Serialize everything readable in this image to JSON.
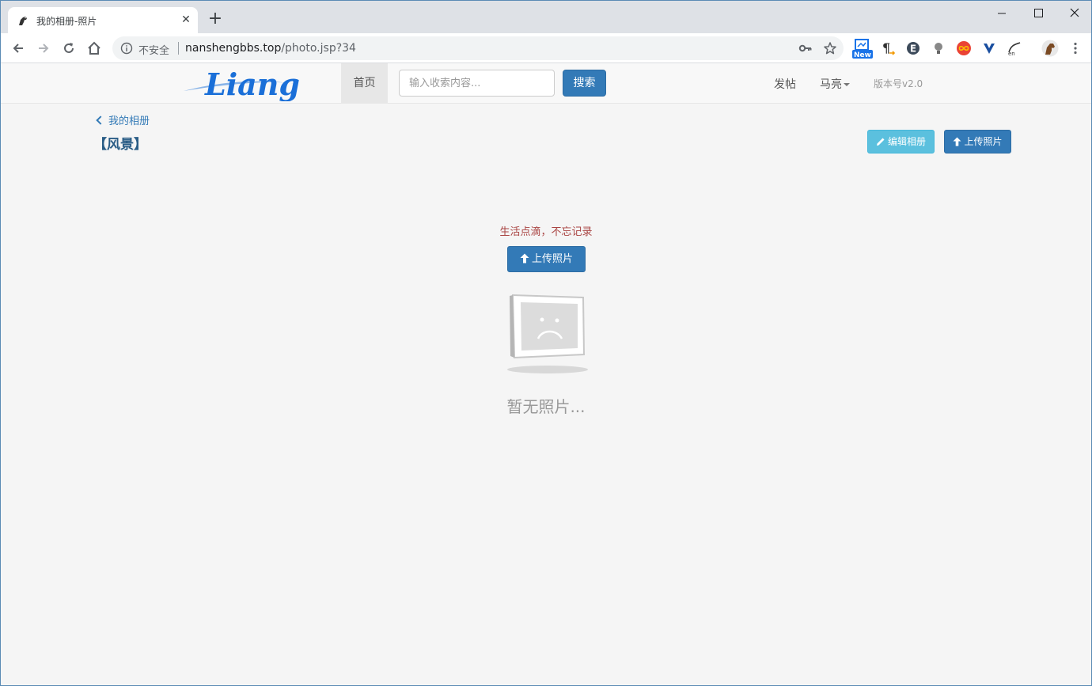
{
  "browser": {
    "tab_title": "我的相册-照片",
    "tab_close": "✕",
    "new_tab": "+",
    "omnibox": {
      "security_label": "不安全",
      "url_host": "nanshengbbs.top",
      "url_path": "/photo.jsp?34"
    },
    "extension_badge": "New"
  },
  "navbar": {
    "logo_text": "Liang",
    "home_label": "首页",
    "search_placeholder": "输入收索内容...",
    "search_button": "搜索",
    "post_label": "发帖",
    "user_label": "马亮",
    "version_label": "版本号v2.0"
  },
  "album": {
    "back_label": "我的相册",
    "title": "【风景】",
    "edit_button": "编辑相册",
    "upload_button": "上传照片"
  },
  "empty_state": {
    "slogan": "生活点滴，不忘记录",
    "upload_button": "上传照片",
    "message": "暂无照片..."
  },
  "colors": {
    "primary": "#337ab7",
    "info": "#5bc0de",
    "danger_text": "#a94442",
    "title_blue": "#2a5d86"
  }
}
